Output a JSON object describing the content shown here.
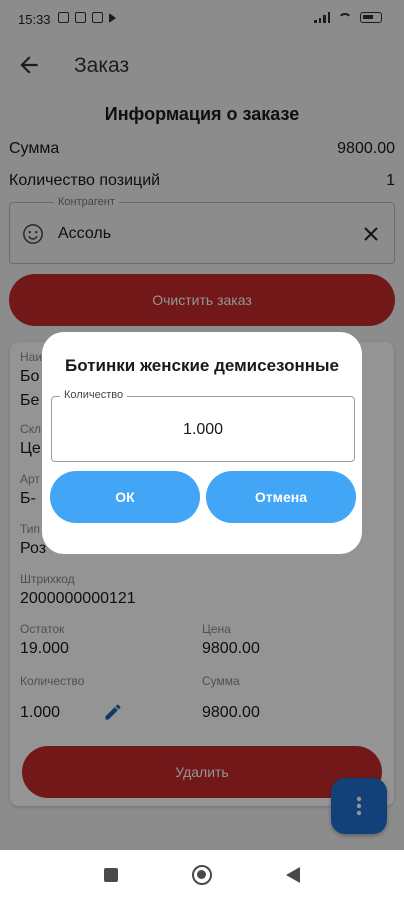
{
  "status_bar": {
    "time": "15:33"
  },
  "app_bar": {
    "title": "Заказ",
    "back_icon": "arrow-left-icon"
  },
  "order_info": {
    "title": "Информация о заказе",
    "sum_label": "Сумма",
    "sum_value": "9800.00",
    "count_label": "Количество позиций",
    "count_value": "1"
  },
  "counterparty": {
    "legend": "Контрагент",
    "value": "Ассоль",
    "icon": "smile-icon"
  },
  "clear_order_button": "Очистить заказ",
  "item_card": {
    "name_label_partial": "Наи",
    "name_line1_partial": "Бо",
    "name_line2_partial": "Бе",
    "warehouse_label_partial": "Скл",
    "warehouse_value_partial": "Це",
    "article_label_partial": "Арт",
    "article_value_partial": "Б-",
    "type_label_partial": "Тип",
    "type_value_partial": "Роз",
    "barcode_label": "Штрихкод",
    "barcode_value": "2000000000121",
    "stock_label": "Остаток",
    "stock_value": "19.000",
    "price_label": "Цена",
    "price_value": "9800.00",
    "qty_label": "Количество",
    "qty_value": "1.000",
    "total_label": "Сумма",
    "total_value": "9800.00",
    "delete_button": "Удалить"
  },
  "colors": {
    "danger": "#c52a2a",
    "primary": "#42a5f5",
    "fab": "#1f6fd1"
  },
  "dialog": {
    "title": "Ботинки женские демисезонные",
    "qty_legend": "Количество",
    "qty_value": "1.000",
    "ok_button": "ОК",
    "cancel_button": "Отмена"
  }
}
